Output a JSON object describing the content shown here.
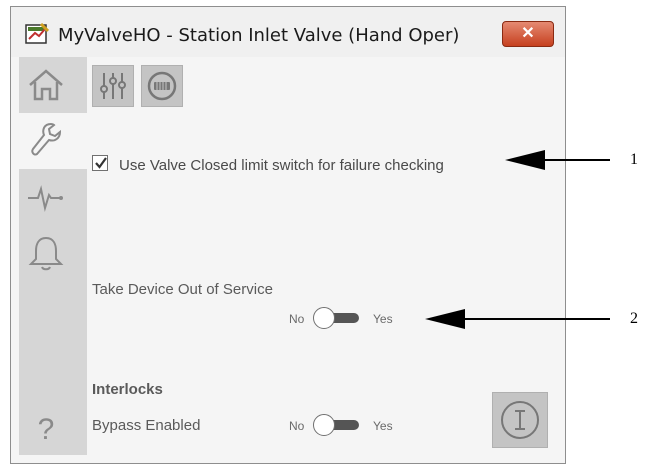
{
  "window": {
    "title": "MyValveHO - Station Inlet Valve (Hand Oper)",
    "close_label": "✕"
  },
  "sidebar": {
    "items": [
      {
        "name": "home",
        "icon": "house-icon",
        "active": false
      },
      {
        "name": "maintenance",
        "icon": "wrench-icon",
        "active": true
      },
      {
        "name": "trends",
        "icon": "trend-icon",
        "active": false
      },
      {
        "name": "alarms",
        "icon": "bell-icon",
        "active": false
      }
    ],
    "help_label": "?"
  },
  "toolbar": {
    "buttons": [
      {
        "name": "configuration",
        "icon": "sliders-icon"
      },
      {
        "name": "operator",
        "icon": "meter-icon"
      }
    ]
  },
  "options": {
    "use_closed_limit": {
      "label": "Use Valve Closed limit switch for failure checking",
      "checked": true
    },
    "out_of_service": {
      "label": "Take Device Out of Service",
      "no_label": "No",
      "yes_label": "Yes",
      "value": "No"
    }
  },
  "interlocks": {
    "heading": "Interlocks",
    "bypass": {
      "label": "Bypass Enabled",
      "no_label": "No",
      "yes_label": "Yes",
      "value": "No"
    }
  },
  "info_button": {
    "icon": "info-icon"
  },
  "callouts": {
    "one": "1",
    "two": "2"
  },
  "colors": {
    "window_bg": "#f5f5f5",
    "sidebar_bg": "#d6d6d6",
    "button_bg": "#c4c4c4",
    "close_red": "#c6401f"
  }
}
